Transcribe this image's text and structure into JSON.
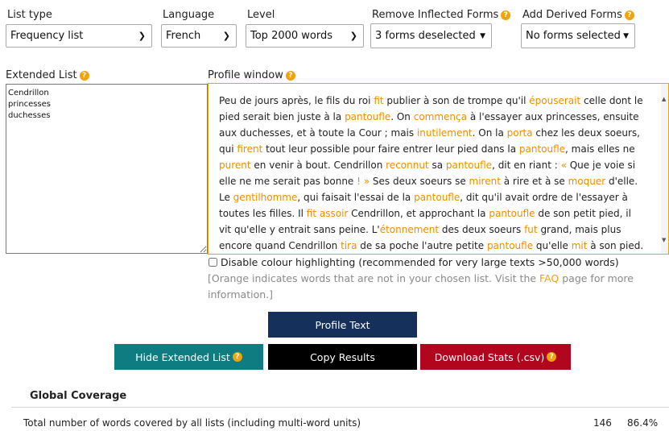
{
  "controls": {
    "list_type": {
      "label": "List type",
      "value": "Frequency list"
    },
    "language": {
      "label": "Language",
      "value": "French"
    },
    "level": {
      "label": "Level",
      "value": "Top 2000 words"
    },
    "inflected": {
      "label": "Remove Inflected Forms",
      "value": "3 forms deselected"
    },
    "derived": {
      "label": "Add Derived Forms",
      "value": "No forms selected"
    }
  },
  "extended_list": {
    "label": "Extended List",
    "value": "Cendrillon\nprincesses\nduchesses"
  },
  "profile_window": {
    "label": "Profile window",
    "segments": [
      {
        "t": "Peu de jours après, le fils du roi "
      },
      {
        "t": "fit",
        "h": true
      },
      {
        "t": " publier à son de trompe qu'il "
      },
      {
        "t": "épouserait",
        "h": true
      },
      {
        "t": " celle dont le pied serait bien juste à la "
      },
      {
        "t": "pantoufle",
        "h": true
      },
      {
        "t": ". On "
      },
      {
        "t": "commença",
        "h": true
      },
      {
        "t": " à l'essayer aux princesses, ensuite aux duchesses, et à toute la Cour ; mais "
      },
      {
        "t": "inutilement",
        "h": true
      },
      {
        "t": ". On la "
      },
      {
        "t": "porta",
        "h": true
      },
      {
        "t": " chez les deux soeurs, qui "
      },
      {
        "t": "firent",
        "h": true
      },
      {
        "t": " tout leur possible pour faire entrer leur pied dans la "
      },
      {
        "t": "pantoufle",
        "h": true
      },
      {
        "t": ", mais elles ne "
      },
      {
        "t": "purent",
        "h": true
      },
      {
        "t": " en venir à bout. Cendrillon "
      },
      {
        "t": "reconnut",
        "h": true
      },
      {
        "t": " sa "
      },
      {
        "t": "pantoufle",
        "h": true
      },
      {
        "t": ", dit en riant : "
      },
      {
        "t": "«",
        "h": true
      },
      {
        "t": " Que je voie si elle ne me serait pas bonne "
      },
      {
        "t": "! »",
        "h": true
      },
      {
        "t": " Ses deux soeurs se "
      },
      {
        "t": "mirent",
        "h": true
      },
      {
        "t": " à rire et à se "
      },
      {
        "t": "moquer",
        "h": true
      },
      {
        "t": " d'elle. Le "
      },
      {
        "t": "gentilhomme",
        "h": true
      },
      {
        "t": ", qui faisait l'essai de la "
      },
      {
        "t": "pantoufle",
        "h": true
      },
      {
        "t": ", dit qu'il avait ordre de l'essayer à toutes les filles. Il "
      },
      {
        "t": "fit",
        "h": true
      },
      {
        "t": " "
      },
      {
        "t": "assoir",
        "h": true
      },
      {
        "t": " Cendrillon, et approchant la "
      },
      {
        "t": "pantoufle",
        "h": true
      },
      {
        "t": " de son petit pied, il vit qu'elle y entrait sans peine. L'"
      },
      {
        "t": "étonnement",
        "h": true
      },
      {
        "t": " des deux soeurs "
      },
      {
        "t": "fut",
        "h": true
      },
      {
        "t": " grand, mais plus encore quand Cendrillon "
      },
      {
        "t": "tira",
        "h": true
      },
      {
        "t": " de sa poche l'autre petite "
      },
      {
        "t": "pantoufle",
        "h": true
      },
      {
        "t": " qu'elle "
      },
      {
        "t": "mit",
        "h": true
      },
      {
        "t": " à son pied."
      }
    ]
  },
  "disable_colour": {
    "label": "Disable colour highlighting (recommended for very large texts >50,000 words)",
    "checked": false
  },
  "note": {
    "before": "[Orange indicates words that are not in your chosen list. Visit the ",
    "link": "FAQ",
    "after": " page for more information.]"
  },
  "buttons": {
    "profile": "Profile Text",
    "hide_extended": "Hide Extended List",
    "copy": "Copy Results",
    "download": "Download Stats (.csv)"
  },
  "coverage": {
    "heading": "Global Coverage",
    "rows": [
      {
        "label": "Total number of words covered by all lists (including multi-word units)",
        "count": "146",
        "percent": "86.4%"
      }
    ]
  },
  "colors": {
    "accent": "#f0a30a",
    "navy": "#16305c",
    "teal": "#0e7c80",
    "black": "#000000",
    "crimson": "#b1061d"
  },
  "icons": {
    "help": "help-question-icon",
    "dropdown": "chevron-down-icon",
    "caret": "caret-down-icon"
  }
}
